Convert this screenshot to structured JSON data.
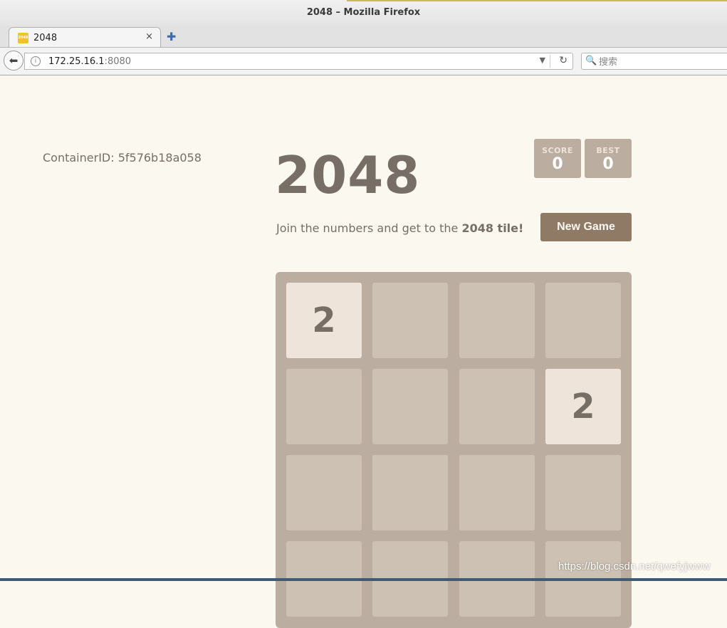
{
  "window": {
    "title": "2048 – Mozilla Firefox"
  },
  "tab": {
    "label": "2048",
    "favicon_text": "2048",
    "close_symbol": "×"
  },
  "newtab_symbol": "✚",
  "navbar": {
    "url_host": "172.25.16.1",
    "url_port": ":8080",
    "search_placeholder": "搜索"
  },
  "page": {
    "container_id": "ContainerID: 5f576b18a058",
    "title": "2048",
    "score_label": "SCORE",
    "score_value": "0",
    "best_label": "BEST",
    "best_value": "0",
    "intro_text": "Join the numbers and get to the ",
    "intro_bold": "2048 tile!",
    "new_game_label": "New Game"
  },
  "board": {
    "rows": [
      [
        "2",
        "",
        "",
        ""
      ],
      [
        "",
        "",
        "",
        "2"
      ],
      [
        "",
        "",
        "",
        ""
      ],
      [
        "",
        "",
        "",
        ""
      ]
    ]
  },
  "watermark": "https://blog.csdn.net/qwefyjwww",
  "colors": {
    "background": "#faf8ef",
    "board": "#bbada0",
    "empty_cell": "#cdc1b4",
    "tile_2": "#eee4da",
    "text": "#776e65",
    "button": "#8f7a66"
  }
}
